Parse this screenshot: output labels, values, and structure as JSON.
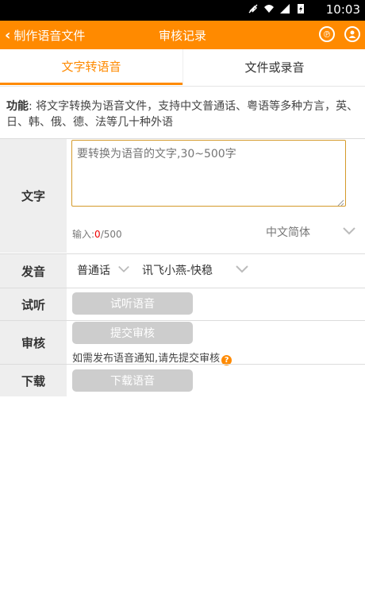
{
  "status_bar": {
    "time": "10:03",
    "icons": [
      "mute-icon",
      "wifi-icon",
      "signal-icon",
      "battery-icon"
    ]
  },
  "title_bar": {
    "back_label": "制作语音文件",
    "title": "审核记录",
    "right_icons": [
      "help-icon",
      "user-icon"
    ]
  },
  "tabs": [
    {
      "label": "文字转语音",
      "active": true
    },
    {
      "label": "文件或录音",
      "active": false
    }
  ],
  "description": {
    "prefix": "功能",
    "text": ": 将文字转换为语音文件，支持中文普通话、粤语等多种方言，英、日、韩、俄、德、法等几十种外语"
  },
  "form": {
    "text_row": {
      "label": "文字",
      "placeholder": "要转换为语音的文字,30~500字",
      "counter_prefix": "输入:",
      "counter_current": "0",
      "counter_max": "/500",
      "language": "中文简体"
    },
    "voice_row": {
      "label": "发音",
      "dialect": "普通话",
      "voice": "讯飞小燕-快稳"
    },
    "listen_row": {
      "label": "试听",
      "button": "试听语音"
    },
    "review_row": {
      "label": "审核",
      "button": "提交审核",
      "hint": "如需发布语音通知,请先提交审核"
    },
    "download_row": {
      "label": "下载",
      "button": "下载语音"
    }
  },
  "colors": {
    "accent": "#ff8a00",
    "label_bg": "#eeeeee",
    "button_disabled": "#cdcdcd"
  }
}
